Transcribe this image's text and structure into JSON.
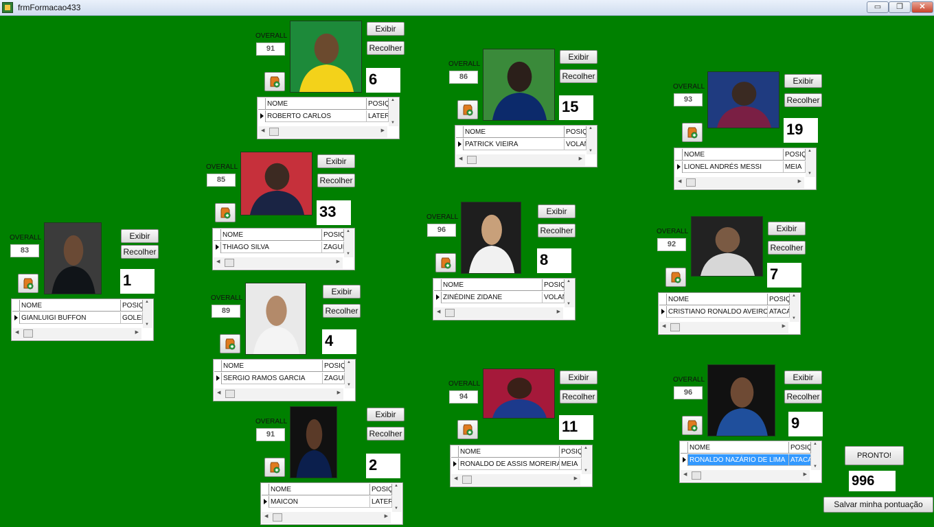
{
  "window": {
    "title": "frmFormacao433",
    "minimize": "▭",
    "restore": "❐",
    "close": "✕"
  },
  "common": {
    "overall_label": "OVERALL",
    "show_label": "Exibir",
    "hide_label": "Recolher",
    "col_nome": "NOME",
    "col_posicao": "POSIÇÃO"
  },
  "players": [
    {
      "overall": "91",
      "number": "6",
      "name": "ROBERTO CARLOS",
      "position": "LATERAL"
    },
    {
      "overall": "86",
      "number": "15",
      "name": "PATRICK VIEIRA",
      "position": "VOLANTE"
    },
    {
      "overall": "93",
      "number": "19",
      "name": "LIONEL ANDRÉS MESSI",
      "position": "MEIA"
    },
    {
      "overall": "85",
      "number": "33",
      "name": "THIAGO SILVA",
      "position": "ZAGUEIRO"
    },
    {
      "overall": "83",
      "number": "1",
      "name": "GIANLUIGI BUFFON",
      "position": "GOLEIRO"
    },
    {
      "overall": "96",
      "number": "8",
      "name": "ZINÉDINE ZIDANE",
      "position": "VOLANTE"
    },
    {
      "overall": "92",
      "number": "7",
      "name": "CRISTIANO RONALDO AVEIRO",
      "position": "ATACANTE"
    },
    {
      "overall": "89",
      "number": "4",
      "name": "SERGIO RAMOS GARCIA",
      "position": "ZAGUEIRO"
    },
    {
      "overall": "94",
      "number": "11",
      "name": "RONALDO DE ASSIS MOREIRA",
      "position": "MEIA"
    },
    {
      "overall": "96",
      "number": "9",
      "name": "RONALDO NAZÁRIO DE LIMA",
      "position": "ATACANTE"
    },
    {
      "overall": "91",
      "number": "2",
      "name": "MAICON",
      "position": "LATERAL"
    }
  ],
  "footer": {
    "ready_label": "PRONTO!",
    "score": "996",
    "save_label": "Salvar minha pontuação"
  },
  "colors": {
    "background": "#008000",
    "selection": "#3399ff"
  }
}
